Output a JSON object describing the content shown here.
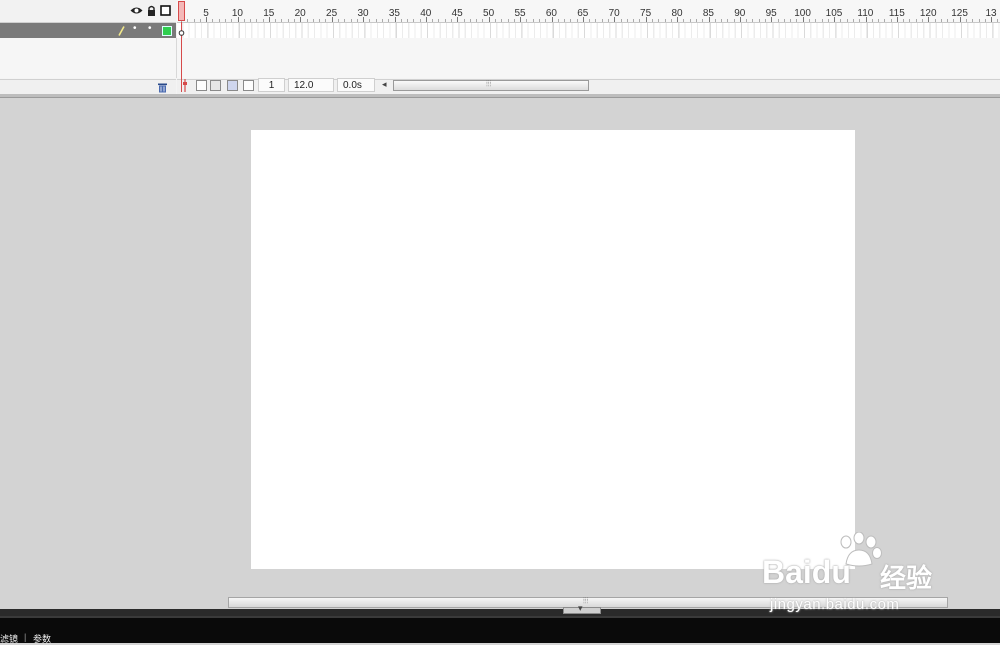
{
  "timeline": {
    "ruler_ticks": [
      "5",
      "10",
      "15",
      "20",
      "25",
      "30",
      "35",
      "40",
      "45",
      "50",
      "55",
      "60",
      "65",
      "70",
      "75",
      "80",
      "85",
      "90",
      "95",
      "100",
      "105",
      "110",
      "115",
      "120",
      "125",
      "13"
    ],
    "header_icons": [
      "eye-icon",
      "lock-icon",
      "outline-icon"
    ],
    "layer": {
      "edit_icon": "pencil-icon",
      "visibility": "•",
      "lock": "•",
      "outline_color": "#2fcf4f"
    },
    "status": {
      "current_frame": "1",
      "frame_rate": "12.0 fps",
      "elapsed_time": "0.0s",
      "scroll_left_arrow": "◂",
      "scroll_grip": "⦙⦙⦙"
    }
  },
  "stage": {
    "background": "#ffffff"
  },
  "bottom": {
    "scroll_grip": "⦙⦙⦙",
    "collapse_arrow": "▾",
    "tabs": [
      "滤镜",
      "参数"
    ],
    "tab_separator": "|"
  },
  "watermark": {
    "logo_text": "Baidu",
    "logo_suffix": "经验",
    "url": "jingyan.baidu.com"
  }
}
